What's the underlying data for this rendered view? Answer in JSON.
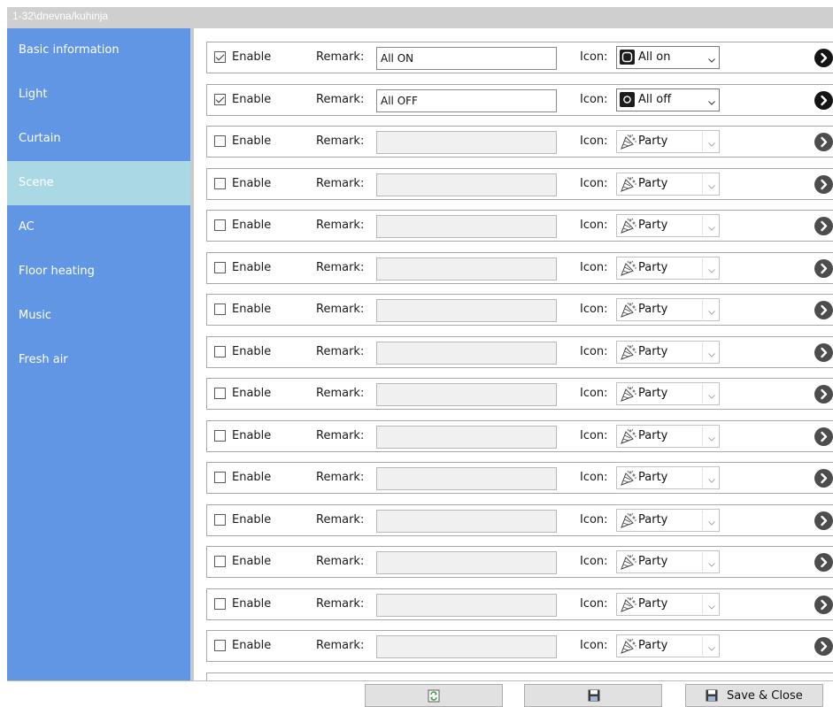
{
  "window": {
    "title": "1-32\\dnevna/kuhinja"
  },
  "sidebar": {
    "items": [
      {
        "label": "Basic information",
        "active": false
      },
      {
        "label": "Light",
        "active": false
      },
      {
        "label": "Curtain",
        "active": false
      },
      {
        "label": "Scene",
        "active": true
      },
      {
        "label": "AC",
        "active": false
      },
      {
        "label": "Floor heating",
        "active": false
      },
      {
        "label": "Music",
        "active": false
      },
      {
        "label": "Fresh air",
        "active": false
      }
    ]
  },
  "rows": [
    {
      "enabled": true,
      "remark": "All ON",
      "icon_label": "All on",
      "icon": "all-on-icon"
    },
    {
      "enabled": true,
      "remark": "All OFF",
      "icon_label": "All off",
      "icon": "all-off-icon"
    },
    {
      "enabled": false,
      "remark": "",
      "icon_label": "Party",
      "icon": "party-icon"
    },
    {
      "enabled": false,
      "remark": "",
      "icon_label": "Party",
      "icon": "party-icon"
    },
    {
      "enabled": false,
      "remark": "",
      "icon_label": "Party",
      "icon": "party-icon"
    },
    {
      "enabled": false,
      "remark": "",
      "icon_label": "Party",
      "icon": "party-icon"
    },
    {
      "enabled": false,
      "remark": "",
      "icon_label": "Party",
      "icon": "party-icon"
    },
    {
      "enabled": false,
      "remark": "",
      "icon_label": "Party",
      "icon": "party-icon"
    },
    {
      "enabled": false,
      "remark": "",
      "icon_label": "Party",
      "icon": "party-icon"
    },
    {
      "enabled": false,
      "remark": "",
      "icon_label": "Party",
      "icon": "party-icon"
    },
    {
      "enabled": false,
      "remark": "",
      "icon_label": "Party",
      "icon": "party-icon"
    },
    {
      "enabled": false,
      "remark": "",
      "icon_label": "Party",
      "icon": "party-icon"
    },
    {
      "enabled": false,
      "remark": "",
      "icon_label": "Party",
      "icon": "party-icon"
    },
    {
      "enabled": false,
      "remark": "",
      "icon_label": "Party",
      "icon": "party-icon"
    },
    {
      "enabled": false,
      "remark": "",
      "icon_label": "Party",
      "icon": "party-icon"
    }
  ],
  "labels": {
    "enable": "Enable",
    "remark": "Remark:",
    "icon": "Icon:"
  },
  "footer": {
    "save_close": "Save & Close"
  },
  "colors": {
    "sidebar": "#6196e5",
    "sidebar_active": "#aad8e4",
    "titlebar": "#cfcfcf"
  }
}
